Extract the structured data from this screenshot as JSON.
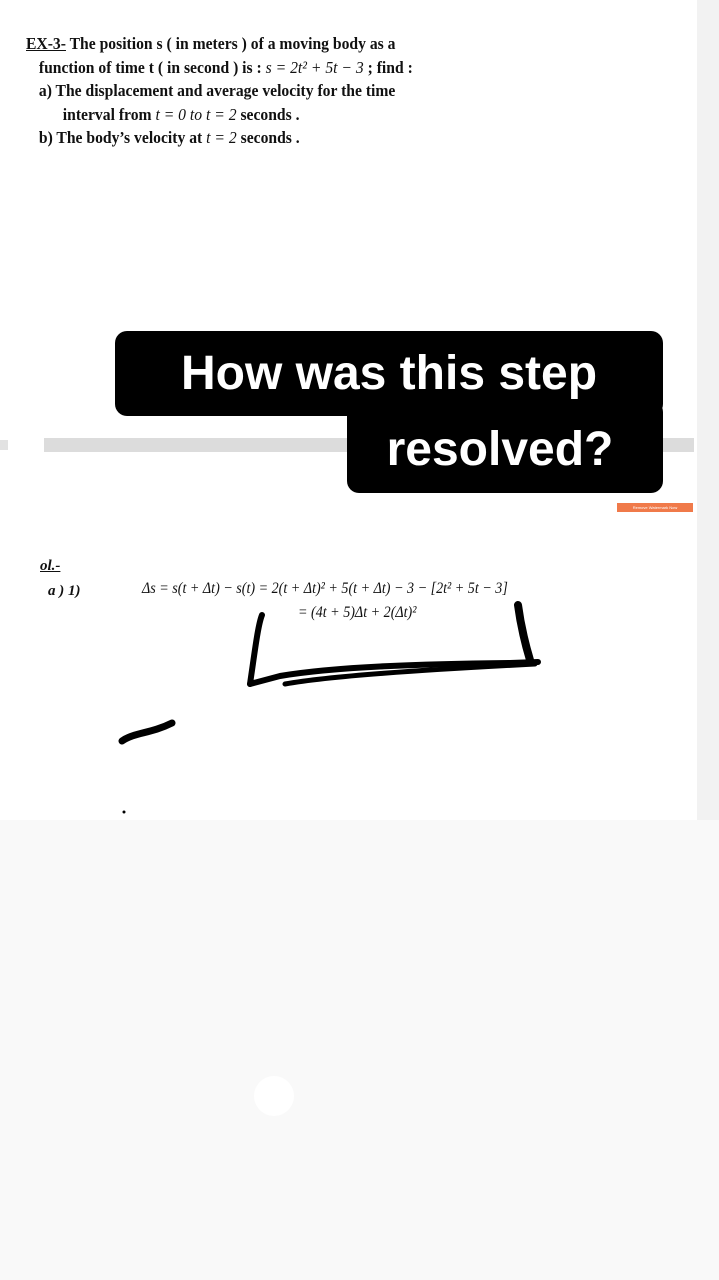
{
  "problem": {
    "label": "EX-3-",
    "line1": " The position s ( in meters ) of a moving body as a",
    "line2_text": "function of time t ( in second ) is :",
    "line2_formula": "s = 2t² + 5t − 3",
    "line2_tail": " ; find :",
    "part_a_line1": "a) The displacement and average velocity for the time",
    "part_a_line2_text": "interval from ",
    "part_a_line2_math": "t = 0  to t = 2",
    "part_a_line2_tail": " seconds .",
    "part_b_text": "b) The body’s velocity at ",
    "part_b_math": "t = 2",
    "part_b_tail": " seconds ."
  },
  "overlay": {
    "question_line1": "How was this step",
    "question_line2": "resolved?",
    "watermark": "Remove Watermark Now"
  },
  "solution": {
    "label": "ol.-",
    "part_label": "a )   1)",
    "equation1": "Δs = s(t + Δt) − s(t) = 2(t + Δt)² + 5(t + Δt) − 3 − [2t² + 5t − 3]",
    "equation2": "= (4t + 5)Δt + 2(Δt)²"
  }
}
